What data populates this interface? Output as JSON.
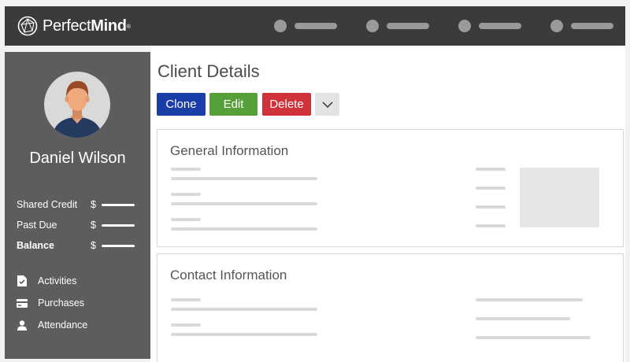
{
  "brand": {
    "name_light": "Perfect",
    "name_bold": "Mind",
    "mark": "®"
  },
  "client": {
    "name": "Daniel Wilson"
  },
  "credits": [
    {
      "label": "Shared Credit",
      "currency": "$",
      "bold": false
    },
    {
      "label": "Past Due",
      "currency": "$",
      "bold": false
    },
    {
      "label": "Balance",
      "currency": "$",
      "bold": true
    }
  ],
  "side_links": [
    {
      "label": "Activities",
      "icon": "checklist-document-icon"
    },
    {
      "label": "Purchases",
      "icon": "credit-card-icon"
    },
    {
      "label": "Attendance",
      "icon": "person-icon"
    }
  ],
  "page": {
    "title": "Client Details"
  },
  "actions": {
    "clone": "Clone",
    "edit": "Edit",
    "delete": "Delete",
    "more_icon": "chevron-down-icon"
  },
  "sections": {
    "general": "General Information",
    "contact": "Contact Information"
  },
  "colors": {
    "topbar": "#3b3b3b",
    "sidebar": "#5d5d5d",
    "clone": "#1a3ea8",
    "edit": "#57a039",
    "delete": "#d0323a"
  }
}
